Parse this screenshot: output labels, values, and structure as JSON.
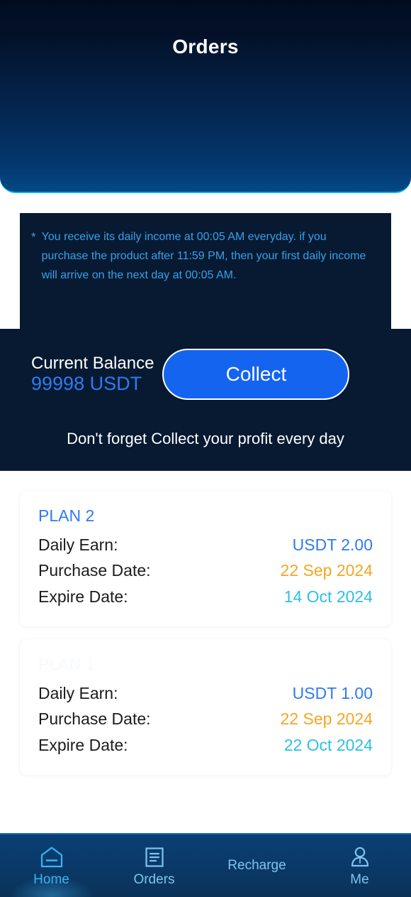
{
  "header": {
    "title": "Orders"
  },
  "notice": {
    "marker": "*",
    "text": "You receive its daily income at 00:05 AM everyday. if you purchase the product after 11:59 PM, then your first daily income will arrive on the next day at 00:05 AM."
  },
  "balance": {
    "label": "Current Balance",
    "value": "99998 USDT",
    "collect_label": "Collect",
    "hint": "Don't forget Collect your profit every day"
  },
  "labels": {
    "daily_earn": "Daily Earn:",
    "purchase_date": "Purchase Date:",
    "expire_date": "Expire Date:"
  },
  "orders": [
    {
      "plan": "PLAN 2",
      "daily_earn": "USDT 2.00",
      "purchase_date": "22 Sep 2024",
      "expire_date": "14 Oct 2024"
    },
    {
      "plan": "PLAN 1",
      "daily_earn": "USDT 1.00",
      "purchase_date": "22 Sep 2024",
      "expire_date": "22 Oct 2024"
    }
  ],
  "bottom_nav": [
    {
      "label": "Home",
      "icon": "home-icon",
      "active": true
    },
    {
      "label": "Orders",
      "icon": "document-icon",
      "active": false
    },
    {
      "label": "Recharge",
      "icon": "none",
      "active": false
    },
    {
      "label": "Me",
      "icon": "person-icon",
      "active": false
    }
  ],
  "colors": {
    "accent_blue": "#2f7bf0",
    "button_blue": "#1464f0",
    "notice_blue": "#3aa0e8",
    "orange": "#f5a623",
    "cyan": "#2bc0e4",
    "panel_dark": "#071a32",
    "nav_blue": "#0a3f73"
  }
}
